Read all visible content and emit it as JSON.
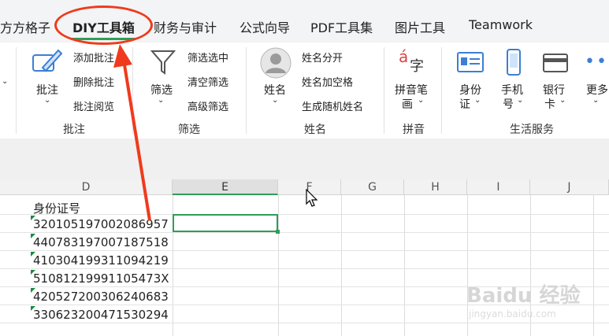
{
  "tabs": [
    {
      "label": "方方格子",
      "active": false
    },
    {
      "label": "DIY工具箱",
      "active": true
    },
    {
      "label": "财务与审计",
      "active": false
    },
    {
      "label": "公式向导",
      "active": false
    },
    {
      "label": "PDF工具集",
      "active": false
    },
    {
      "label": "图片工具",
      "active": false
    },
    {
      "label": "Teamwork",
      "active": false
    }
  ],
  "ribbon": {
    "annotate": {
      "main": "批注",
      "items": [
        "添加批注",
        "删除批注",
        "批注阅览"
      ],
      "group": "批注"
    },
    "filter": {
      "main": "筛选",
      "items": [
        "筛选选中",
        "清空筛选",
        "高级筛选"
      ],
      "group": "筛选"
    },
    "name": {
      "main": "姓名",
      "items": [
        "姓名分开",
        "姓名加空格",
        "生成随机姓名"
      ],
      "group": "姓名"
    },
    "pinyin": {
      "main1": "拼音笔",
      "main2": "画",
      "group": "拼音",
      "icon_glyph1": "á",
      "icon_glyph2": "字"
    },
    "life": {
      "id_line1": "身份",
      "id_line2": "证",
      "phone_line1": "手机",
      "phone_line2": "号",
      "bank_line1": "银行",
      "bank_line2": "卡",
      "more": "更多",
      "group": "生活服务"
    }
  },
  "sheet": {
    "columns": [
      "D",
      "E",
      "F",
      "G",
      "H",
      "I",
      "J"
    ],
    "selected_column": "E",
    "header_cell": "身份证号",
    "rows": [
      "320105197002086957",
      "440783197007187518",
      "410304199311094219",
      "51081219991105473X",
      "420527200306240683",
      "330623200471530294"
    ]
  },
  "colors": {
    "accent_green": "#2e9e57",
    "annotation_red": "#f03a1d"
  },
  "watermark": {
    "text": "Baidu 经验",
    "url": "jingyan.baidu.com"
  }
}
